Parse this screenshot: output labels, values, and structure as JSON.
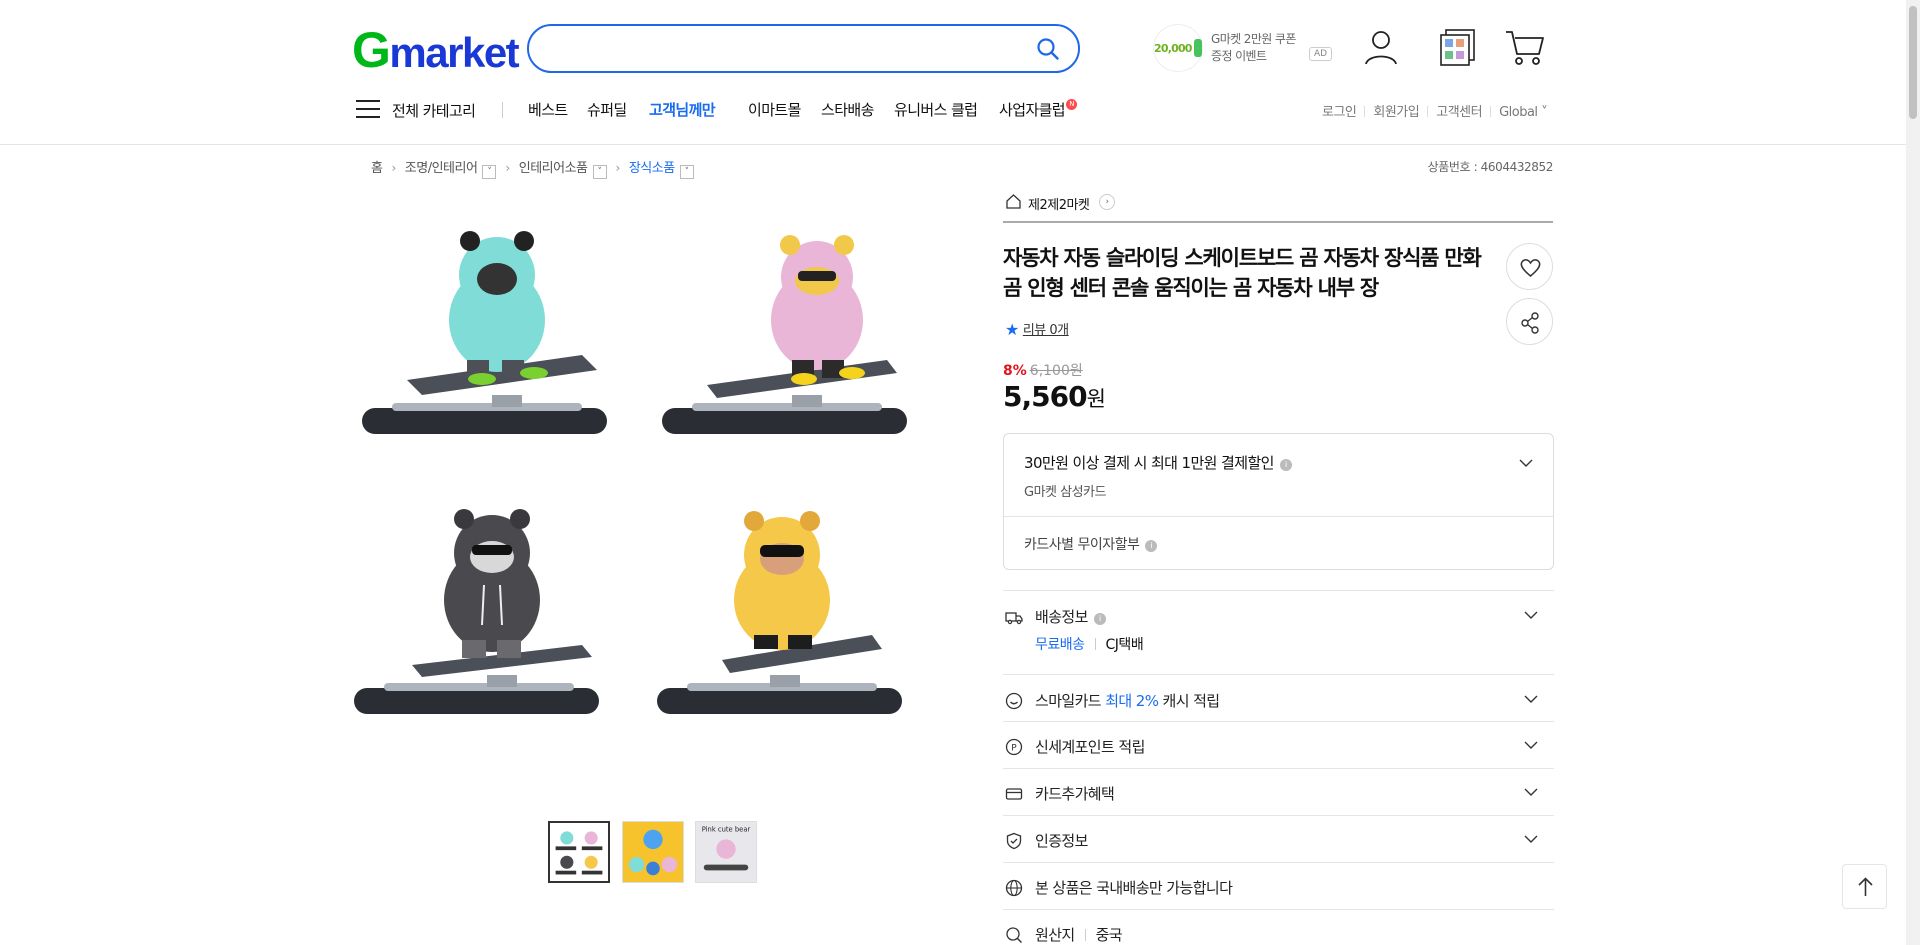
{
  "header": {
    "logo_g": "G",
    "logo_rest": "market",
    "search": {
      "placeholder": ""
    },
    "coupon": {
      "amount": "20,000",
      "line1": "G마켓 2만원 쿠폰",
      "line2": "증정 이벤트",
      "ad": "AD"
    },
    "icons": [
      "user-icon",
      "recent-items-icon",
      "cart-icon"
    ]
  },
  "nav": {
    "all_categories": "전체 카테고리",
    "items": [
      {
        "label": "베스트"
      },
      {
        "label": "슈퍼딜"
      },
      {
        "label": "고객님께만"
      },
      {
        "label": "이마트몰"
      },
      {
        "label": "스타배송"
      },
      {
        "label": "유니버스 클럽"
      },
      {
        "label": "사업자클럽"
      }
    ],
    "new_badge": "N",
    "util": [
      "로그인",
      "회원가입",
      "고객센터",
      "Global"
    ]
  },
  "breadcrumb": {
    "items": [
      "홈",
      "조명/인테리어",
      "인테리어소품",
      "장식소품"
    ],
    "product_no": "상품번호 : 4604432852"
  },
  "product": {
    "shop_name": "제2제2마켓",
    "title": "자동차 자동 슬라이딩 스케이트보드 곰 자동차 장식품 만화 곰 인형 센터 콘솔 움직이는 곰 자동차 내부 장",
    "review": "리뷰 0개",
    "discount_rate": "8%",
    "original_price": "6,100원",
    "price": "5,560",
    "price_unit": "원",
    "thumb_text": "Pink cute bear"
  },
  "card_benefit": {
    "headline": "30만원 이상 결제 시 최대 1만원 결제할인",
    "card": "G마켓 삼성카드",
    "installment": "카드사별 무이자할부"
  },
  "rows": {
    "shipping": {
      "label": "배송정보",
      "free": "무료배송",
      "carrier": "CJ택배"
    },
    "smilecard": {
      "pre": "스마일카드",
      "blue": "최대 2%",
      "post": "캐시 적립"
    },
    "ssgpoint": "신세계포인트 적립",
    "cardextra": "카드추가혜택",
    "cert": "인증정보",
    "domestic": "본 상품은 국내배송만 가능합니다",
    "origin": {
      "label": "원산지",
      "value": "중국"
    }
  },
  "colors": {
    "brand_green": "#00b71a",
    "brand_blue": "#1a38d6",
    "accent": "#1a6cf0",
    "sale_red": "#e0161e"
  }
}
